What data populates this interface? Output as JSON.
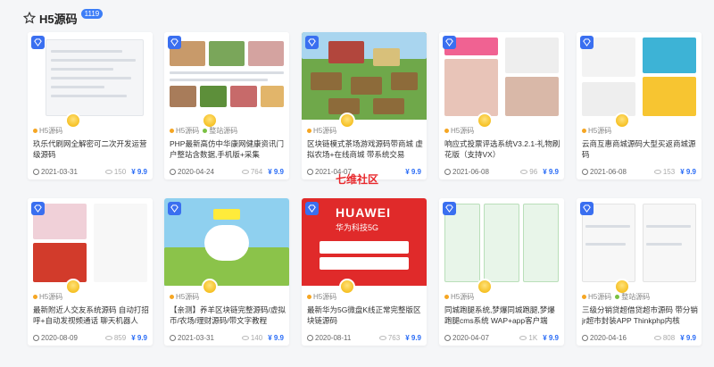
{
  "header": {
    "title": "H5源码",
    "count": "1119"
  },
  "watermark": "七维社区",
  "cards": [
    {
      "tags": [
        {
          "label": "H5源码",
          "color": "#f5a623"
        }
      ],
      "desc": "玖乐代刷网全解密可二次开发运营级源码",
      "date": "2021-03-31",
      "views": "150",
      "price": "¥ 9.9"
    },
    {
      "tags": [
        {
          "label": "H5源码",
          "color": "#f5a623"
        },
        {
          "label": "整站源码",
          "color": "#7ac143"
        }
      ],
      "desc": "PHP最新高仿中华康网健康资讯门户整站含数据,手机版+采集",
      "date": "2020-04-24",
      "views": "764",
      "price": "¥ 9.9"
    },
    {
      "tags": [
        {
          "label": "H5源码",
          "color": "#f5a623"
        }
      ],
      "desc": "区块链模式茶场游戏源码带商城 虚拟农场+在线商城 带系统交易",
      "date": "2021-04-07",
      "views": "",
      "price": "¥ 9.9"
    },
    {
      "tags": [
        {
          "label": "H5源码",
          "color": "#f5a623"
        }
      ],
      "desc": "响应式投票评选系统V3.2.1-礼物刷花版（支持VX）",
      "date": "2021-06-08",
      "views": "96",
      "price": "¥ 9.9"
    },
    {
      "tags": [
        {
          "label": "H5源码",
          "color": "#f5a623"
        }
      ],
      "desc": "云商互惠商城源码大型买返商城源码",
      "date": "2021-06-08",
      "views": "153",
      "price": "¥ 9.9"
    },
    {
      "tags": [
        {
          "label": "H5源码",
          "color": "#f5a623"
        }
      ],
      "desc": "最新附近人交友系统源码 自动打招呼+自动发视频通话 聊天机器人",
      "date": "2020-08-09",
      "views": "859",
      "price": "¥ 9.9"
    },
    {
      "tags": [
        {
          "label": "H5源码",
          "color": "#f5a623"
        }
      ],
      "desc": "【亲测】养羊区块链完整源码/虚拟币/农场/理财源码/带文字教程",
      "date": "2021-03-31",
      "views": "140",
      "price": "¥ 9.9"
    },
    {
      "tags": [
        {
          "label": "H5源码",
          "color": "#f5a623"
        }
      ],
      "desc": "最新华为5G微盘K线正常完整版区块链源码",
      "date": "2020-08-11",
      "views": "763",
      "price": "¥ 9.9"
    },
    {
      "tags": [
        {
          "label": "H5源码",
          "color": "#f5a623"
        }
      ],
      "desc": "同城跑腿系统,梦爆同城跑腿,梦爆跑腿cms系统 WAP+app客户端",
      "date": "2020-04-07",
      "views": "1K",
      "price": "¥ 9.9"
    },
    {
      "tags": [
        {
          "label": "H5源码",
          "color": "#f5a623"
        },
        {
          "label": "整站源码",
          "color": "#7ac143"
        }
      ],
      "desc": "三级分销贷超借贷超市源码 带分销 jr超市封装APP Thinkphp内核",
      "date": "2020-04-16",
      "views": "808",
      "price": "¥ 9.9"
    }
  ],
  "thumbs": {
    "huawei_brand": "HUAWEI",
    "huawei_sub": "华为科技5G"
  }
}
